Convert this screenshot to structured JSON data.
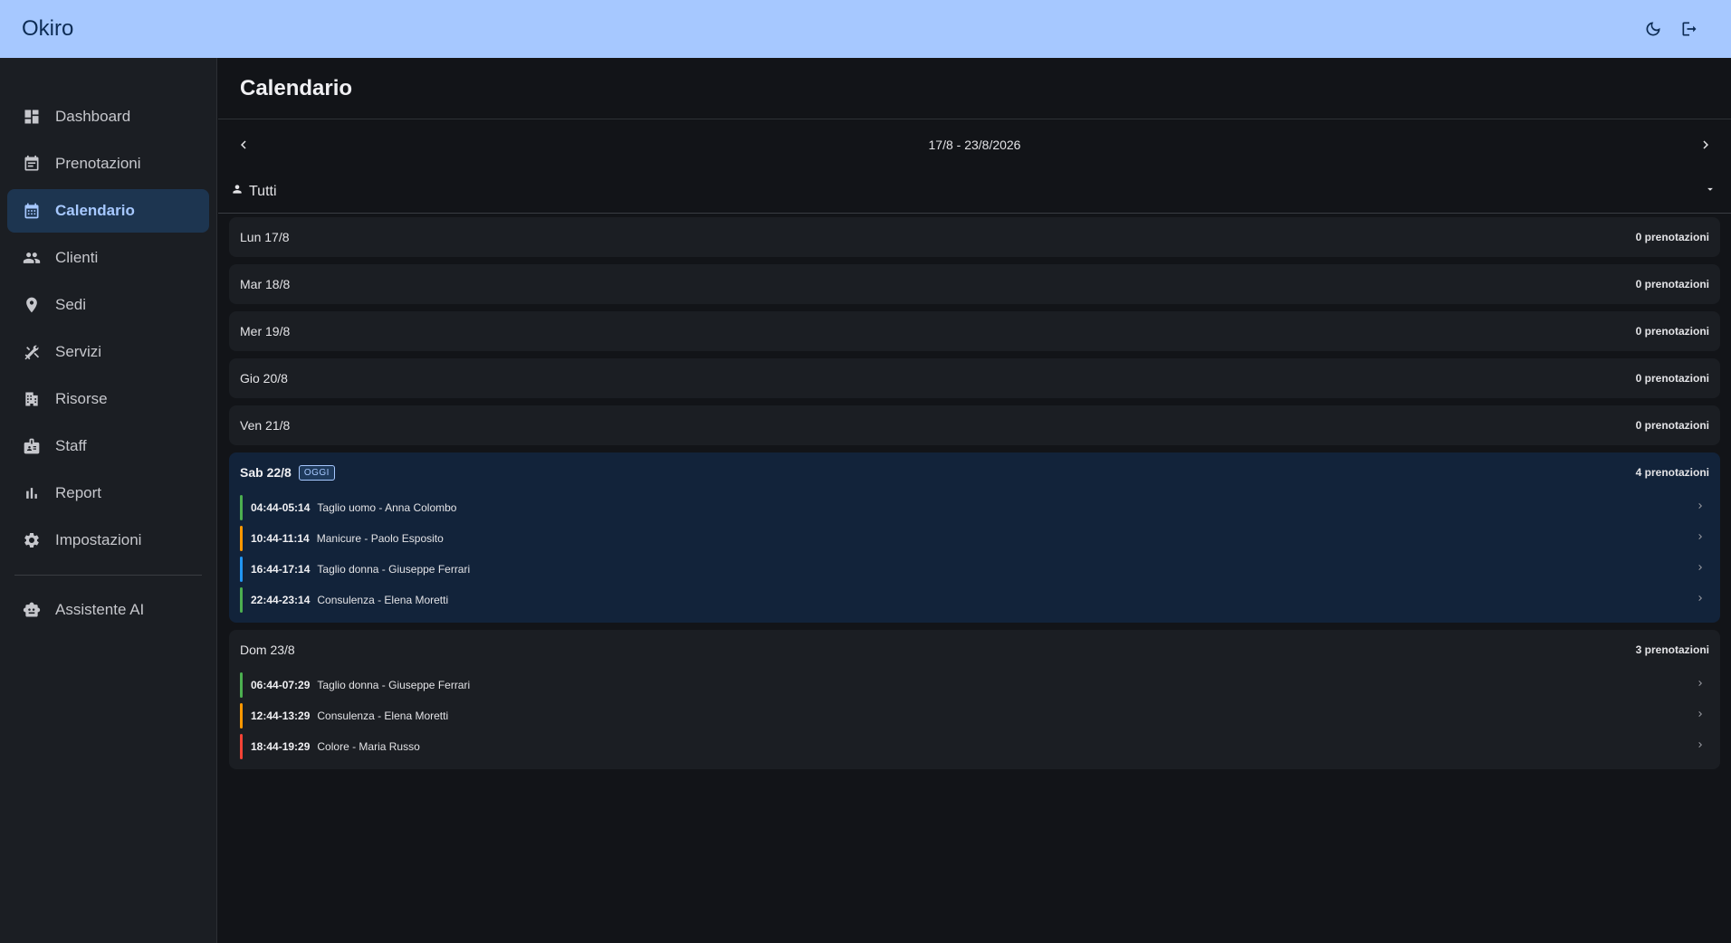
{
  "app": {
    "title": "Okiro"
  },
  "topbar": {
    "theme_icon": "moon-icon",
    "logout_icon": "logout-icon"
  },
  "sidebar": {
    "items": [
      {
        "label": "Dashboard",
        "icon": "dashboard-icon",
        "active": false
      },
      {
        "label": "Prenotazioni",
        "icon": "event-note-icon",
        "active": false
      },
      {
        "label": "Calendario",
        "icon": "calendar-icon",
        "active": true
      },
      {
        "label": "Clienti",
        "icon": "people-icon",
        "active": false
      },
      {
        "label": "Sedi",
        "icon": "location-pin-icon",
        "active": false
      },
      {
        "label": "Servizi",
        "icon": "tools-icon",
        "active": false
      },
      {
        "label": "Risorse",
        "icon": "building-icon",
        "active": false
      },
      {
        "label": "Staff",
        "icon": "badge-icon",
        "active": false
      },
      {
        "label": "Report",
        "icon": "bar-chart-icon",
        "active": false
      },
      {
        "label": "Impostazioni",
        "icon": "gear-icon",
        "active": false
      }
    ],
    "assistant": {
      "label": "Assistente AI",
      "icon": "robot-icon"
    }
  },
  "main": {
    "title": "Calendario",
    "week_range": "17/8 - 23/8/2026",
    "filter": {
      "value": "Tutti"
    },
    "colors": {
      "green": "#4caf50",
      "orange": "#ff9800",
      "blue": "#2196f3",
      "red": "#f44336"
    },
    "days": [
      {
        "label": "Lun 17/8",
        "count": "0 prenotazioni",
        "today": false,
        "bookings": []
      },
      {
        "label": "Mar 18/8",
        "count": "0 prenotazioni",
        "today": false,
        "bookings": []
      },
      {
        "label": "Mer 19/8",
        "count": "0 prenotazioni",
        "today": false,
        "bookings": []
      },
      {
        "label": "Gio 20/8",
        "count": "0 prenotazioni",
        "today": false,
        "bookings": []
      },
      {
        "label": "Ven 21/8",
        "count": "0 prenotazioni",
        "today": false,
        "bookings": []
      },
      {
        "label": "Sab 22/8",
        "count": "4 prenotazioni",
        "today": true,
        "badge": "OGGI",
        "bookings": [
          {
            "time": "04:44-05:14",
            "desc": "Taglio uomo - Anna Colombo",
            "color": "#4caf50"
          },
          {
            "time": "10:44-11:14",
            "desc": "Manicure - Paolo Esposito",
            "color": "#ff9800"
          },
          {
            "time": "16:44-17:14",
            "desc": "Taglio donna - Giuseppe Ferrari",
            "color": "#2196f3"
          },
          {
            "time": "22:44-23:14",
            "desc": "Consulenza - Elena Moretti",
            "color": "#4caf50"
          }
        ]
      },
      {
        "label": "Dom 23/8",
        "count": "3 prenotazioni",
        "today": false,
        "bookings": [
          {
            "time": "06:44-07:29",
            "desc": "Taglio donna - Giuseppe Ferrari",
            "color": "#4caf50"
          },
          {
            "time": "12:44-13:29",
            "desc": "Consulenza - Elena Moretti",
            "color": "#ff9800"
          },
          {
            "time": "18:44-19:29",
            "desc": "Colore - Maria Russo",
            "color": "#f44336"
          }
        ]
      }
    ]
  }
}
